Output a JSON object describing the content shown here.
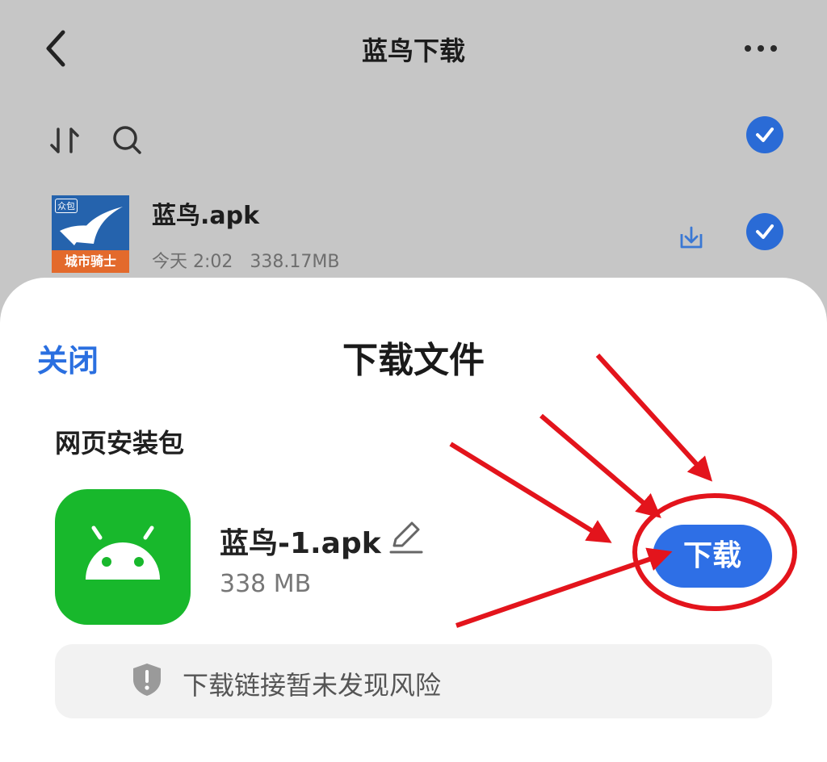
{
  "header": {
    "title": "蓝鸟下载",
    "back_icon": "chevron-left-icon",
    "more_icon": "more-horizontal-icon"
  },
  "toolbar": {
    "sort_icon": "sort-icon",
    "search_icon": "search-icon",
    "select_all_checked": true
  },
  "file": {
    "name": "蓝鸟.apk",
    "meta": "今天 2:02   338.17MB",
    "thumb_band_text": "城市骑士",
    "thumb_tag_text": "众包",
    "selected": true
  },
  "sheet": {
    "close_label": "关闭",
    "title": "下载文件",
    "section_label": "网页安装包",
    "app_name": "蓝鸟-1.apk",
    "app_size": "338 MB",
    "download_label": "下载",
    "safety_text": "下载链接暂未发现风险"
  },
  "colors": {
    "accent": "#2e6fe6",
    "check": "#2a6bd6",
    "android_green": "#18b82c",
    "annotation_red": "#e3141c"
  }
}
